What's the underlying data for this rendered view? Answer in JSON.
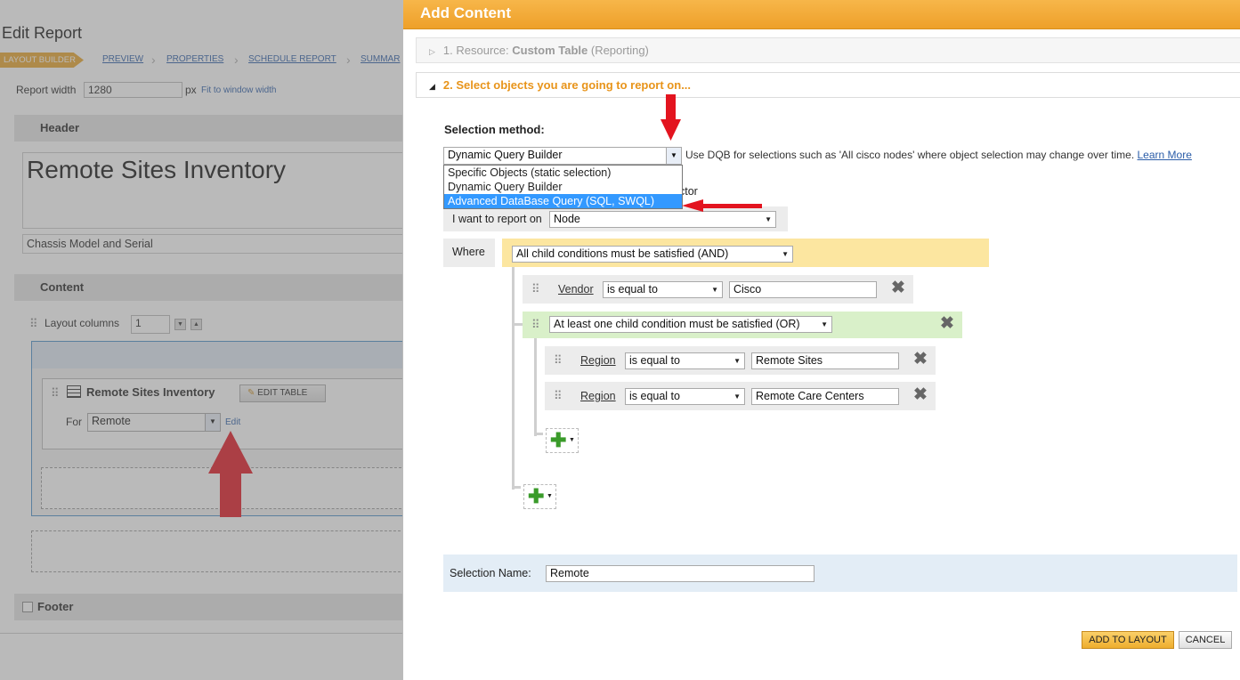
{
  "report": {
    "title": "Edit Report",
    "tabs": [
      "LAYOUT BUILDER",
      "PREVIEW",
      "PROPERTIES",
      "SCHEDULE REPORT",
      "SUMMAR"
    ],
    "report_width_label": "Report width",
    "report_width_value": "1280",
    "px_label": "px",
    "fit_link": "Fit to window width",
    "header_section": "Header",
    "header_title": "Remote Sites Inventory",
    "header_subtitle": "Chassis Model and Serial",
    "content_section": "Content",
    "layout_columns_label": "Layout columns",
    "layout_columns_value": "1",
    "resource_title": "Remote Sites Inventory",
    "edit_table_label": "EDIT TABLE",
    "for_label": "For",
    "for_value": "Remote",
    "edit_link": "Edit",
    "footer_label": "Footer"
  },
  "dialog": {
    "title": "Add Content",
    "step1_prefix": "1. Resource: ",
    "step1_bold": "Custom Table",
    "step1_suffix": " (Reporting)",
    "step2": "2. Select objects you are going to report on...",
    "selection_method_label": "Selection method:",
    "selection_method_value": "Dynamic Query Builder",
    "dropdown_options": [
      "Specific Objects (static selection)",
      "Dynamic Query Builder",
      "Advanced DataBase Query (SQL, SWQL)"
    ],
    "hint": "Use DQB for selections such as 'All cisco nodes' where object selection may change over time.",
    "learn_more": "Learn More",
    "obscured_suffix": "ctor",
    "report_on_label": "I want to report on",
    "report_on_value": "Node",
    "where_label": "Where",
    "and_condition": "All child conditions must be satisfied (AND)",
    "vendor_field": "Vendor",
    "vendor_op": "is equal to",
    "vendor_value": "Cisco",
    "or_condition": "At least one child condition must be satisfied (OR)",
    "region1_field": "Region",
    "region1_op": "is equal to",
    "region1_value": "Remote Sites",
    "region2_field": "Region",
    "region2_op": "is equal to",
    "region2_value": "Remote Care Centers",
    "selection_name_label": "Selection Name:",
    "selection_name_value": "Remote",
    "add_to_layout": "ADD TO LAYOUT",
    "cancel": "CANCEL"
  },
  "colors": {
    "accent_orange": "#eea02a",
    "link_blue": "#2a5ca8",
    "arrow_red": "#e3141f",
    "and_bg": "#fce6a0",
    "or_bg": "#d9f0c9"
  }
}
